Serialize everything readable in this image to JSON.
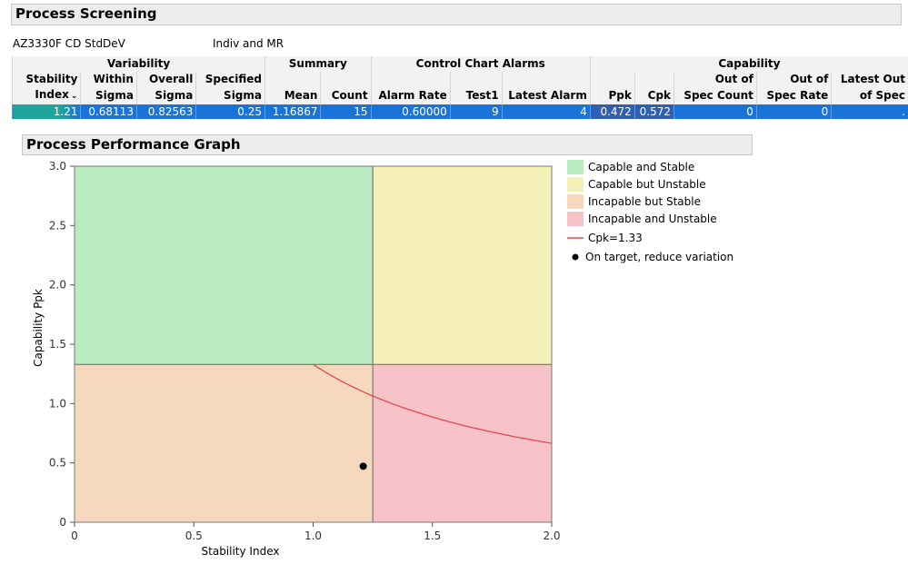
{
  "header": {
    "title": "Process Screening"
  },
  "process_label": "AZ3330F CD StdDeV",
  "chart_type_label": "Indiv and MR",
  "table": {
    "groups": [
      "Variability",
      "Summary",
      "Control Chart Alarms",
      "Capability"
    ],
    "columns": [
      {
        "line1": "Stability",
        "line2": "Index"
      },
      {
        "line1": "Within",
        "line2": "Sigma"
      },
      {
        "line1": "Overall",
        "line2": "Sigma"
      },
      {
        "line1": "Specified",
        "line2": "Sigma"
      },
      {
        "line1": "",
        "line2": "Mean"
      },
      {
        "line1": "",
        "line2": "Count"
      },
      {
        "line1": "",
        "line2": "Alarm Rate"
      },
      {
        "line1": "",
        "line2": "Test1"
      },
      {
        "line1": "",
        "line2": "Latest Alarm"
      },
      {
        "line1": "",
        "line2": "Ppk"
      },
      {
        "line1": "",
        "line2": "Cpk"
      },
      {
        "line1": "Out of",
        "line2": "Spec Count"
      },
      {
        "line1": "Out of",
        "line2": "Spec Rate"
      },
      {
        "line1": "Latest Out",
        "line2": "of Spec"
      }
    ],
    "row": [
      "1.21",
      "0.68113",
      "0.82563",
      "0.25",
      "1.16867",
      "15",
      "0.60000",
      "9",
      "4",
      "0.472",
      "0.572",
      "0",
      "0",
      "."
    ]
  },
  "graph_header": {
    "title": "Process Performance Graph"
  },
  "chart_data": {
    "type": "scatter",
    "xlabel": "Stability Index",
    "ylabel": "Capability Ppk",
    "xlim": [
      0,
      2.0
    ],
    "ylim": [
      0,
      3.0
    ],
    "x_ticks": [
      "0",
      "0.5",
      "1.0",
      "1.5",
      "2.0"
    ],
    "y_ticks": [
      "0",
      "0.5",
      "1.0",
      "1.5",
      "2.0",
      "2.5",
      "3.0"
    ],
    "stability_threshold": 1.25,
    "capability_threshold": 1.33,
    "regions": [
      {
        "name": "Capable and Stable",
        "color": "#b9ebc0"
      },
      {
        "name": "Capable but Unstable",
        "color": "#f4f0b6"
      },
      {
        "name": "Incapable but Stable",
        "color": "#f6d9bc"
      },
      {
        "name": "Incapable and Unstable",
        "color": "#f8c2c9"
      }
    ],
    "cpk_curve": {
      "name": "Cpk=1.33",
      "cpk": 1.33,
      "x_start": 1.0,
      "x_end": 2.0,
      "color": "#e8464e"
    },
    "points": [
      {
        "name": "On target, reduce variation",
        "x": 1.21,
        "y": 0.472,
        "color": "#000000"
      }
    ],
    "grid": false,
    "legend_position": "right"
  }
}
